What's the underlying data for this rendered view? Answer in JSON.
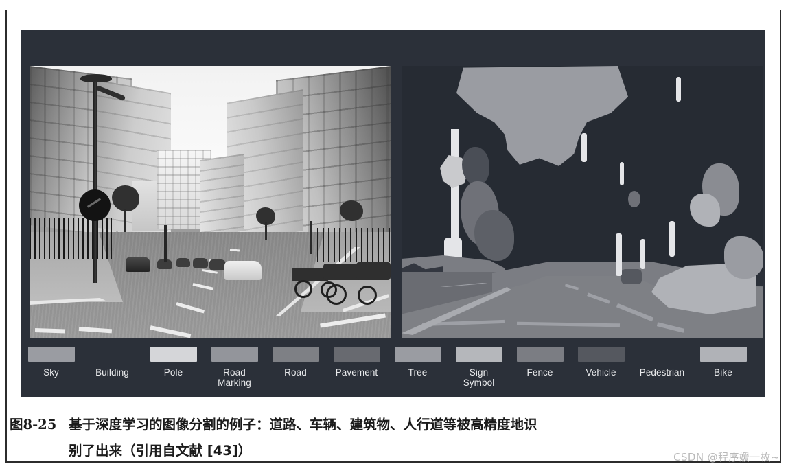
{
  "figure": {
    "panel_background": "#2b3039",
    "caption_number": "图8-25",
    "caption_line1": "基于深度学习的图像分割的例子：道路、车辆、建筑物、人行道等被高精度地识",
    "caption_line2": "别了出来（引用自文献 [43]）",
    "watermark": "CSDN @程序媛一枚~"
  },
  "panels": {
    "photo": {
      "alt": "grayscale street photograph of a city road lined with buildings, parked cars and motorcycles"
    },
    "segmap": {
      "alt": "semantic segmentation map of the same street scene rendered in flat gray class colors"
    }
  },
  "legend": {
    "items": [
      {
        "label": "Sky",
        "color": "#9a9ca2",
        "has_swatch": true
      },
      {
        "label": "Building",
        "color": "#2b3039",
        "has_swatch": false
      },
      {
        "label": "Pole",
        "color": "#d5d6d9",
        "has_swatch": true
      },
      {
        "label": "Road\nMarking",
        "color": "#93959b",
        "has_swatch": true
      },
      {
        "label": "Road",
        "color": "#7e8085",
        "has_swatch": true
      },
      {
        "label": "Pavement",
        "color": "#686a70",
        "has_swatch": true
      },
      {
        "label": "Tree",
        "color": "#9a9ca2",
        "has_swatch": true
      },
      {
        "label": "Sign\nSymbol",
        "color": "#b5b7bb",
        "has_swatch": true
      },
      {
        "label": "Fence",
        "color": "#7b7d83",
        "has_swatch": true
      },
      {
        "label": "Vehicle",
        "color": "#55585f",
        "has_swatch": true
      },
      {
        "label": "Pedestrian",
        "color": "#2b3039",
        "has_swatch": false
      },
      {
        "label": "Bike",
        "color": "#b0b2b7",
        "has_swatch": true
      }
    ]
  },
  "segmentation_regions": {
    "sky": "#9a9ca2",
    "building": "#262b33",
    "road": "#7e8085",
    "pavement": "#6a6c72",
    "pole": "#e4e5e8",
    "tree": "#4a4e56",
    "vehicle": "#b0b2b7",
    "sign": "#b5b7bb",
    "fence": "#7b7d83",
    "marking": "#9ea0a6"
  }
}
